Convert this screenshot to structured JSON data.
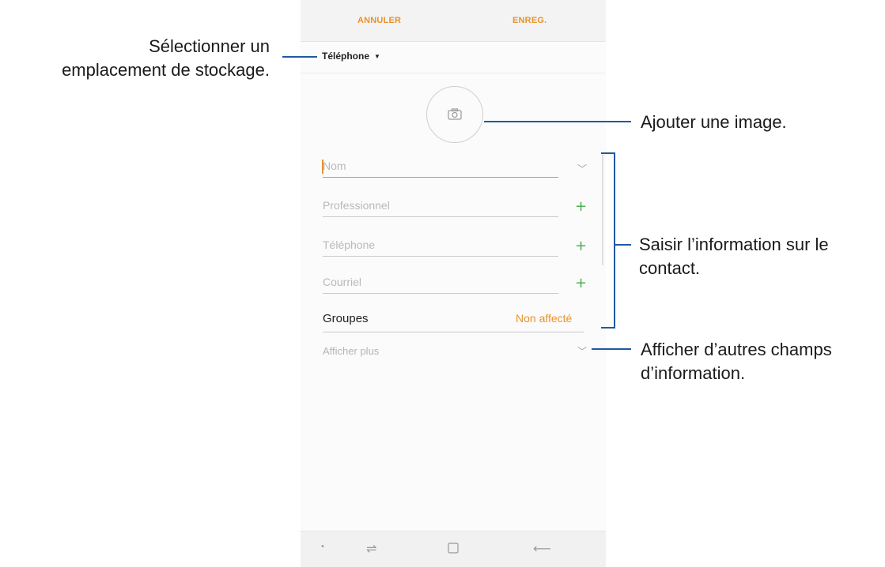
{
  "toolbar": {
    "cancel_label": "ANNULER",
    "save_label": "ENREG."
  },
  "storage": {
    "label": "Téléphone",
    "caret": "▼"
  },
  "form": {
    "name_placeholder": "Nom",
    "company_placeholder": "Professionnel",
    "phone_placeholder": "Téléphone",
    "email_placeholder": "Courriel",
    "groups_label": "Groupes",
    "groups_value": "Non affecté",
    "show_more_label": "Afficher plus"
  },
  "icons": {
    "camera": "camera-icon",
    "expand": "chevron-down-icon",
    "add": "plus-icon",
    "recent_apps": "recent-apps-icon",
    "home": "home-icon",
    "back": "back-icon"
  },
  "colors": {
    "accent": "#e8922c",
    "add_green": "#4caf50",
    "callout_line": "#1f5aa0"
  },
  "callouts": {
    "storage": [
      "Sélectionner un",
      "emplacement de stockage."
    ],
    "image": [
      "Ajouter une image."
    ],
    "info": [
      "Saisir l’information sur le",
      "contact."
    ],
    "more": [
      "Afficher d’autres champs",
      "d’information."
    ]
  }
}
